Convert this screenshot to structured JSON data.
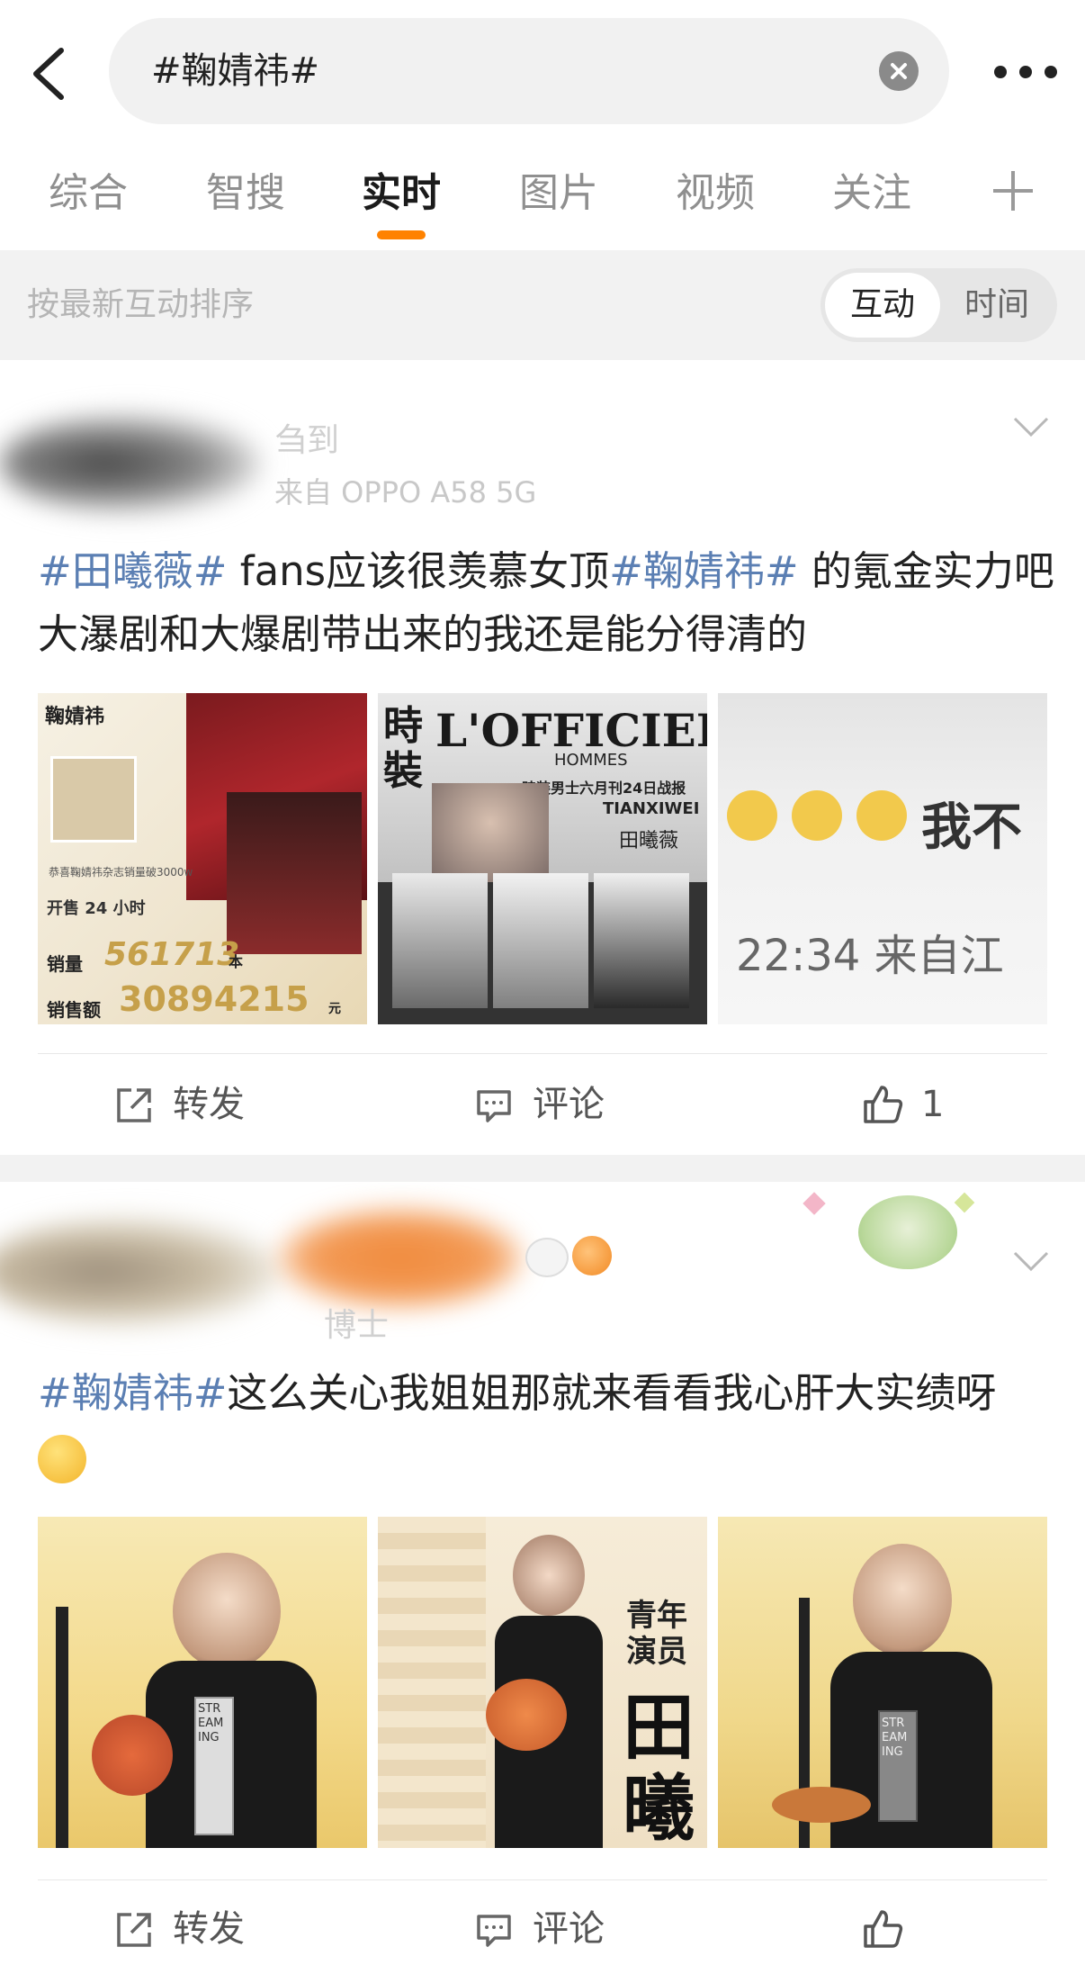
{
  "search": {
    "query": "#鞠婧祎#"
  },
  "tabs": [
    {
      "label": "综合"
    },
    {
      "label": "智搜"
    },
    {
      "label": "实时"
    },
    {
      "label": "图片"
    },
    {
      "label": "视频"
    },
    {
      "label": "关注"
    }
  ],
  "active_tab": "实时",
  "sort": {
    "label": "按最新互动排序",
    "option_interaction": "互动",
    "option_time": "时间",
    "selected": "互动"
  },
  "colors": {
    "accent": "#ff8200",
    "topic": "#5b7fb3",
    "background_gray": "#f2f2f2"
  },
  "posts": [
    {
      "user_name": "刍到",
      "source": "来自 OPPO A58 5G",
      "topic1": "#田曦薇#",
      "text1": " fans应该很羡慕女顶",
      "topic2": "#鞠婧祎#",
      "text2": " 的氪金实力吧 大瀑剧和大爆剧带出来的我还是能分得清的",
      "images": [
        {
          "title": "鞠婧祎",
          "line1": "恭喜鞠婧祎杂志销量破3000w",
          "line2": "开售 24 小时",
          "sales_label": "销量",
          "sales": "561713",
          "sales_unit": "本",
          "revenue_label": "销售额",
          "revenue": "30894215",
          "revenue_unit": "元"
        },
        {
          "title": "L'OFFICIEL",
          "subtitle": "HOMMES",
          "tag": "時裝",
          "caption": "時装男士六月刊24日战报",
          "name_en": "TIANXIWEI",
          "name_cn": "田曦薇"
        },
        {
          "text_top": "我不",
          "text_bottom": "22:34 来自江"
        }
      ],
      "repost_label": "转发",
      "comment_label": "评论",
      "like_count": "1"
    },
    {
      "user_name": "博士",
      "topic1": "#鞠婧祎#",
      "text1": "这么关心我姐姐那就来看看我心肝大实绩呀",
      "images": [
        {
          "badge": "STREAMING"
        },
        {
          "side_text": "青年演员",
          "name": "田曦"
        },
        {
          "badge": "STREAMING"
        }
      ],
      "repost_label": "转发",
      "comment_label": "评论"
    }
  ]
}
